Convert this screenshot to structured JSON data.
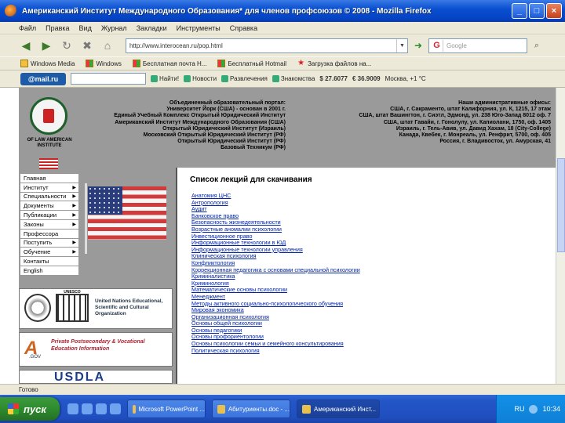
{
  "window": {
    "title": "Американский Институт Международного Образования* для членов профсоюзов © 2008 - Mozilla Firefox",
    "buttons": [
      "_",
      "□",
      "×"
    ]
  },
  "menu": [
    "Файл",
    "Правка",
    "Вид",
    "Журнал",
    "Закладки",
    "Инструменты",
    "Справка"
  ],
  "nav": {
    "url": "http://www.interocean.ru/pop.html",
    "search_placeholder": "Google",
    "search_engine": "G"
  },
  "bookmarks": [
    "Windows Media",
    "Windows",
    "Бесплатная почта H...",
    "Бесплатный Hotmail",
    "Загрузка файлов на..."
  ],
  "mailbar": {
    "logo": "@mail.ru",
    "items": [
      "Найти!",
      "Новости",
      "Развлечения",
      "Знакомства"
    ],
    "usd": "$ 27.6077",
    "eur": "€ 36.9009",
    "weather": "Москва, +1 °C"
  },
  "header": {
    "crest_caption": "OF LAW AMERICAN INSTITUTE",
    "center_lines": [
      "Объединенный образовательный портал:",
      "Университет Йорк (США) - основан в 2001 г.",
      "Единый Учебный Комплекс Открытый Юридический Институт",
      "Американский Институт Международного Образования (США)",
      "Открытый Юридический Институт (Израиль)",
      "Московский Открытый Юридический Институт (РФ)",
      "Открытый Юридический Институт (РФ)",
      "Базовый Техникум (РФ)"
    ],
    "right_lines": [
      "Наши административные офисы:",
      "США, г. Сакраменто, штат Калифорния, ул. К, 1215, 17 этаж",
      "США, штат Вашингтон, г. Сиэтл, Эдмонд, ул. 238 Юго-Запад 8012 оф. 7",
      "США, штат Гавайи, г. Гонолулу, ул. Капиолани, 1750, оф. 1405",
      "Израиль, г. Тель-Авив, ул. Давид Хахам, 18 (City-College)",
      "Канада, Квебек, г. Монреаль, ул. Ренфрит, 5700, оф. 405",
      "Россия, г. Владивосток, ул. Амурская, 41"
    ]
  },
  "left_nav": [
    {
      "label": "Главная",
      "arrow": false
    },
    {
      "label": "Институт",
      "arrow": true
    },
    {
      "label": "Специальности",
      "arrow": true
    },
    {
      "label": "Документы",
      "arrow": true
    },
    {
      "label": "Публикации",
      "arrow": true
    },
    {
      "label": "Законы",
      "arrow": true
    },
    {
      "label": "Профессора",
      "arrow": false
    },
    {
      "label": "Поступить",
      "arrow": true
    },
    {
      "label": "Обучение",
      "arrow": true
    },
    {
      "label": "Контакты",
      "arrow": false
    },
    {
      "label": "English",
      "arrow": false
    }
  ],
  "logos": {
    "unesco_label": "UNESCO",
    "unesco_text": "United Nations Educational, Scientific and Cultural Organization",
    "ppsv_text": "Private Postsecondary & Vocational Education Information",
    "ppsv_gov": ".GOV",
    "usdla": "USDLA"
  },
  "popup": {
    "title": "Список лекций для скачивания",
    "lectures": [
      "Анатомия ЦНС",
      "Антропология",
      "Аудит",
      "Банковское право",
      "Безопасность жизнедеятельности",
      "Возрастные аномалии психологии",
      "Инвестиционное право",
      "Информационные технологии в ЮД",
      "Информационные технологии управления",
      "Клиническая психология",
      "Конфликтология",
      "Коррекционная педагогика с основами специальной психологии",
      "Криминалистика",
      "Криминология",
      "Математические основы психологии",
      "Менеджмент",
      "Методы активного социально-психологического обучения",
      "Мировая экономика",
      "Организационная психология",
      "Основы общей психологии",
      "Основы педагогики",
      "Основы профориентологии",
      "Основы психологии семьи и семейного консультирования",
      "Политическая психология"
    ]
  },
  "status": "Готово",
  "taskbar": {
    "start": "пуск",
    "tasks": [
      "Microsoft PowerPoint ...",
      "Абитуриенты.doc - ...",
      "Американский Инст..."
    ],
    "lang": "RU",
    "clock": "10:34"
  }
}
